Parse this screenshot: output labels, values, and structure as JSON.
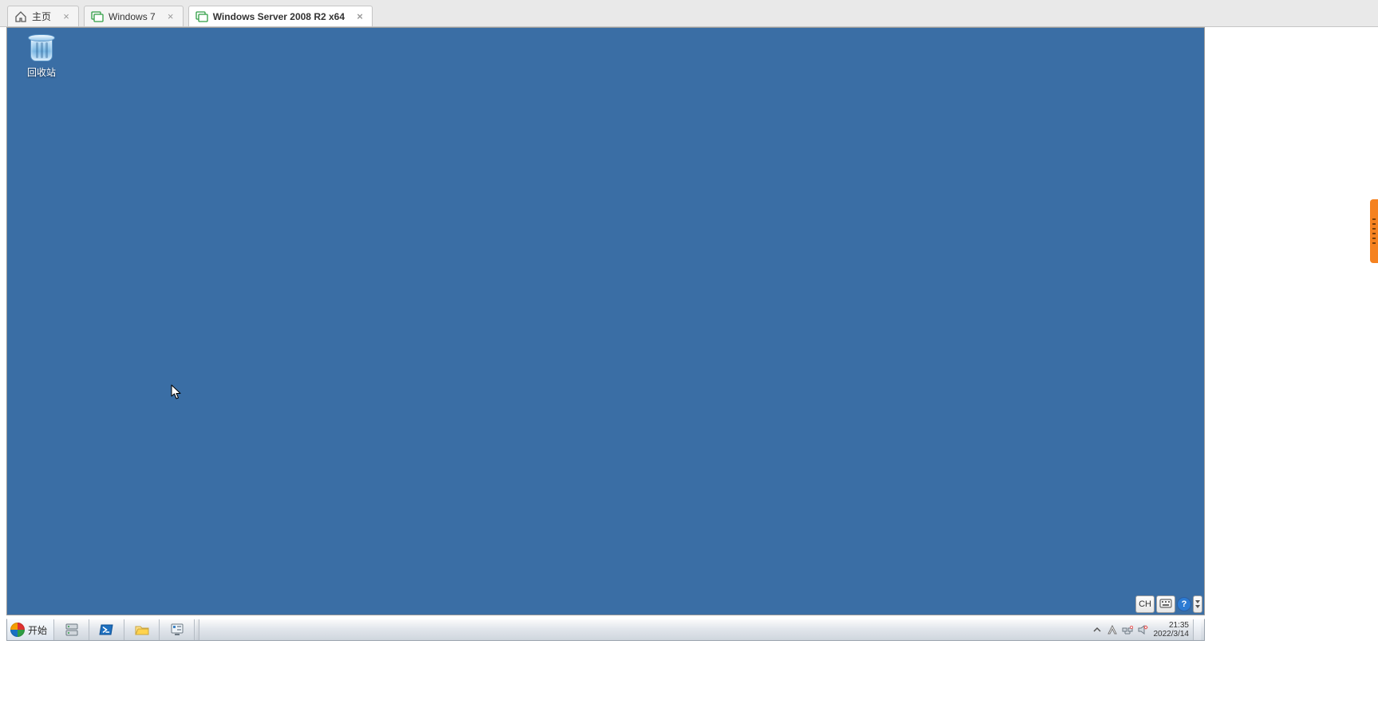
{
  "host_tabs": [
    {
      "label": "主页",
      "icon": "home-icon",
      "active": false
    },
    {
      "label": "Windows 7",
      "icon": "vm-icon",
      "active": false
    },
    {
      "label": "Windows Server 2008 R2 x64",
      "icon": "vm-icon",
      "active": true
    }
  ],
  "desktop": {
    "recycle_bin_label": "回收站"
  },
  "lang_bar": {
    "ime": "CH"
  },
  "start": {
    "label": "开始"
  },
  "tray": {
    "time": "21:35",
    "date": "2022/3/14"
  }
}
